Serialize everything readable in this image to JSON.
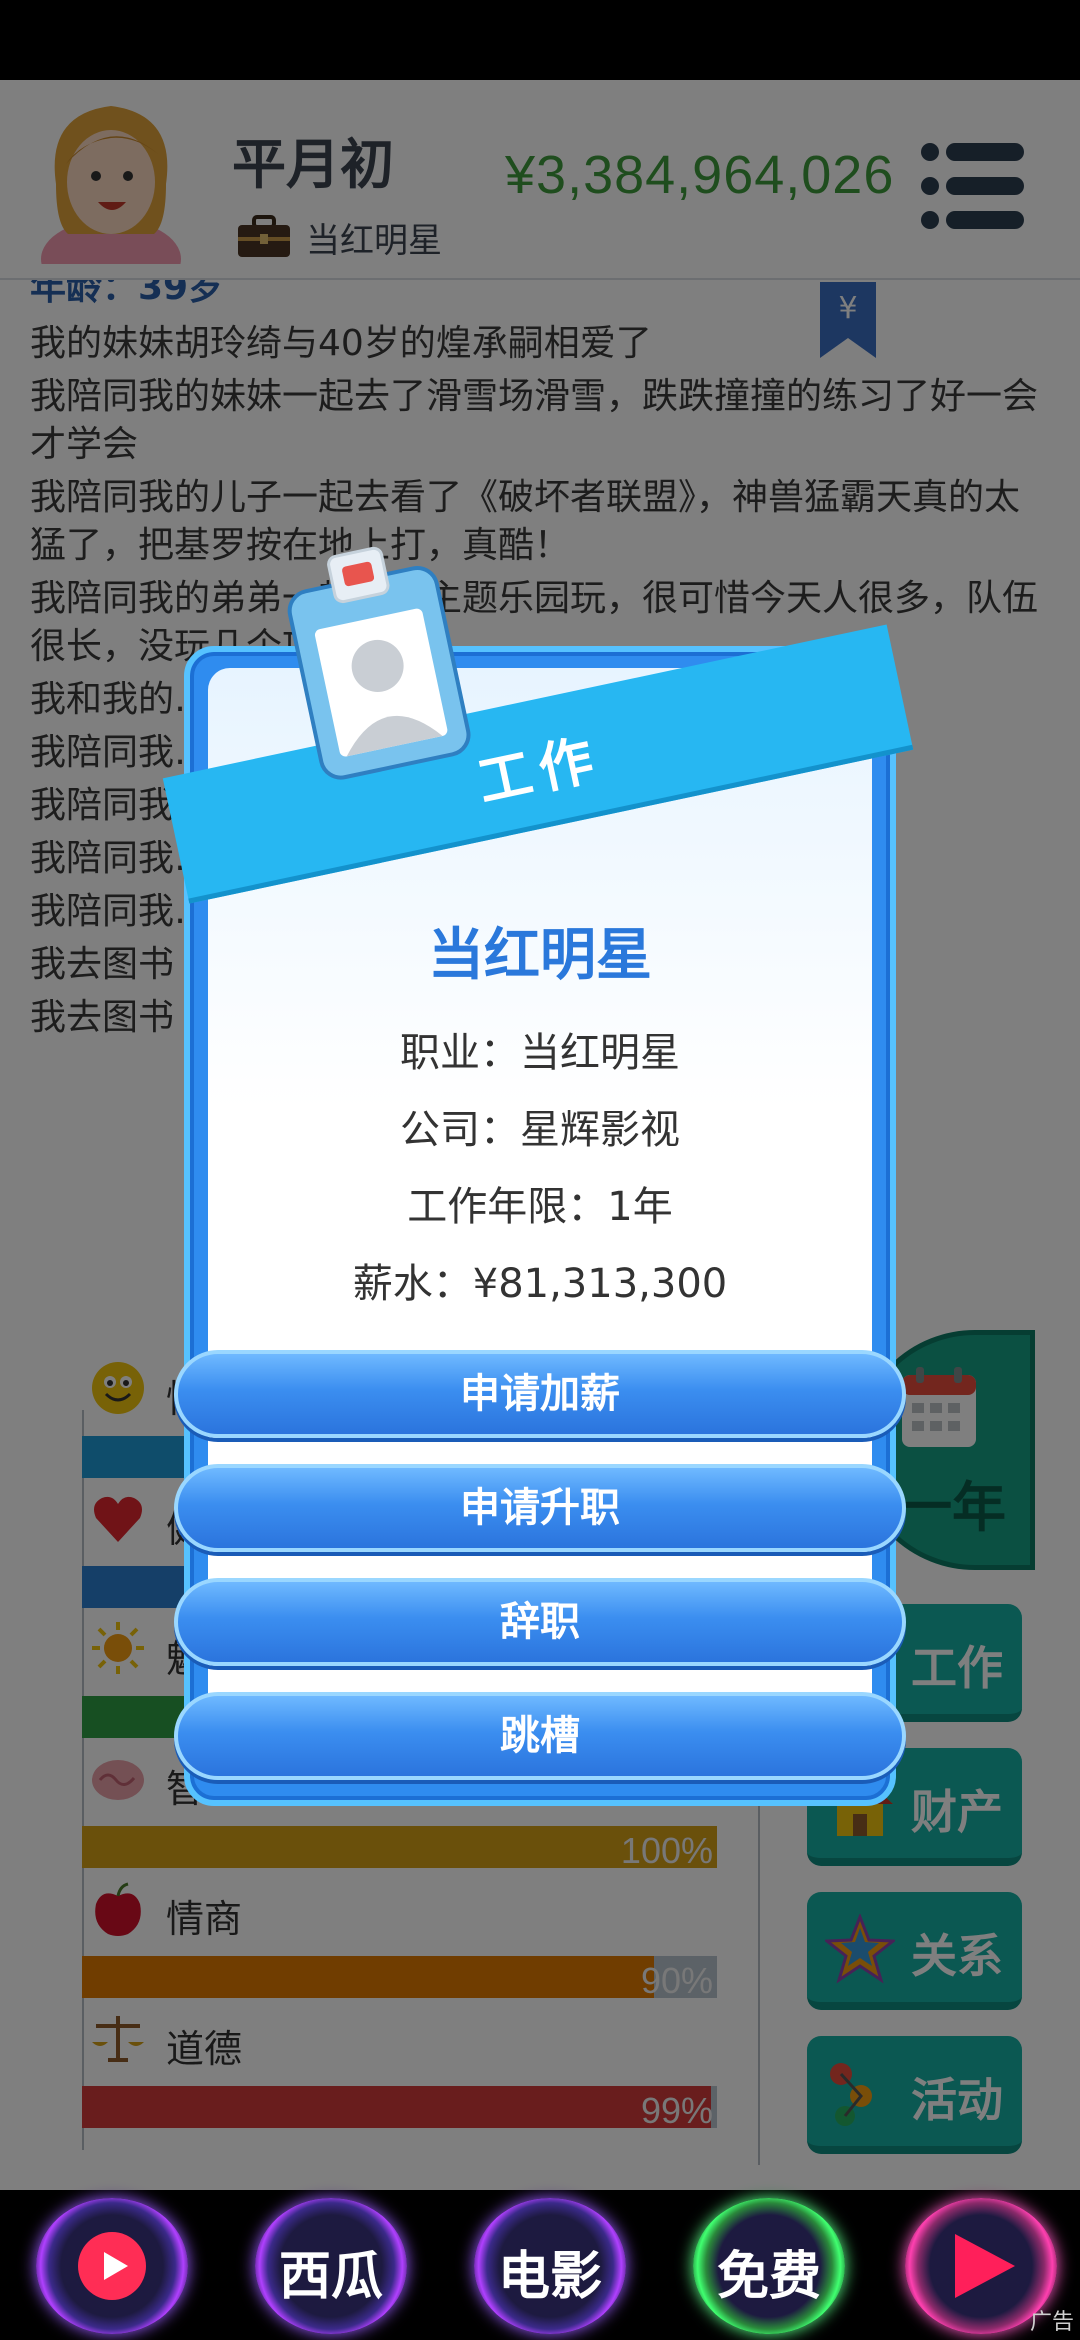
{
  "header": {
    "player_name": "平月初",
    "job_title": "当红明星",
    "money": "¥3,384,964,026"
  },
  "log": {
    "age": "年龄：39岁",
    "lines": [
      "我的妹妹胡玲绮与40岁的煌承嗣相爱了",
      "我陪同我的妹妹一起去了滑雪场滑雪，跌跌撞撞的练习了好一会才学会",
      "我陪同我的儿子一起去看了《破坏者联盟》，神兽猛霸天真的太猛了，把基罗按在地上打，真酷！",
      "我陪同我的弟弟一起去了主题乐园玩，很可惜今天人很多，队伍很长，没玩几个项目。",
      "我和我的……漫",
      "我陪同我……小猪跑的可真快",
      "我陪同我……错这一部没有洗脑",
      "我陪同我……的练习了好一会才学会",
      "我陪同我……若有机会来这里野",
      "我去图书",
      "我去图书"
    ]
  },
  "stats": [
    {
      "label": "快乐",
      "percent": "",
      "color": "#1e9ad6",
      "fill": 1.0,
      "icon": "smiley-icon"
    },
    {
      "label": "健康",
      "percent": "",
      "color": "#2a7fd0",
      "fill": 1.0,
      "icon": "heart-icon"
    },
    {
      "label": "魅力",
      "percent": "",
      "color": "#2f9e44",
      "fill": 1.0,
      "icon": "sun-icon"
    },
    {
      "label": "智商",
      "percent": "100%",
      "color": "#d4a017",
      "fill": 1.0,
      "icon": "brain-icon"
    },
    {
      "label": "情商",
      "percent": "90%",
      "color": "#e07b00",
      "fill": 0.9,
      "icon": "apple-icon"
    },
    {
      "label": "道德",
      "percent": "99%",
      "color": "#d23a3a",
      "fill": 0.99,
      "icon": "scales-icon"
    }
  ],
  "side": {
    "next_year": "一年",
    "buttons": [
      "工作",
      "财产",
      "关系",
      "活动"
    ]
  },
  "modal": {
    "banner": "工作",
    "heading": "当红明星",
    "occupation": "职业：当红明星",
    "company": "公司：星辉影视",
    "years": "工作年限：1年",
    "salary": "薪水：¥81,313,300",
    "actions": [
      "申请加薪",
      "申请升职",
      "辞职",
      "跳槽"
    ]
  },
  "ads": {
    "items": [
      "",
      "西瓜",
      "电影",
      "免费",
      ""
    ],
    "tag": "广告"
  }
}
